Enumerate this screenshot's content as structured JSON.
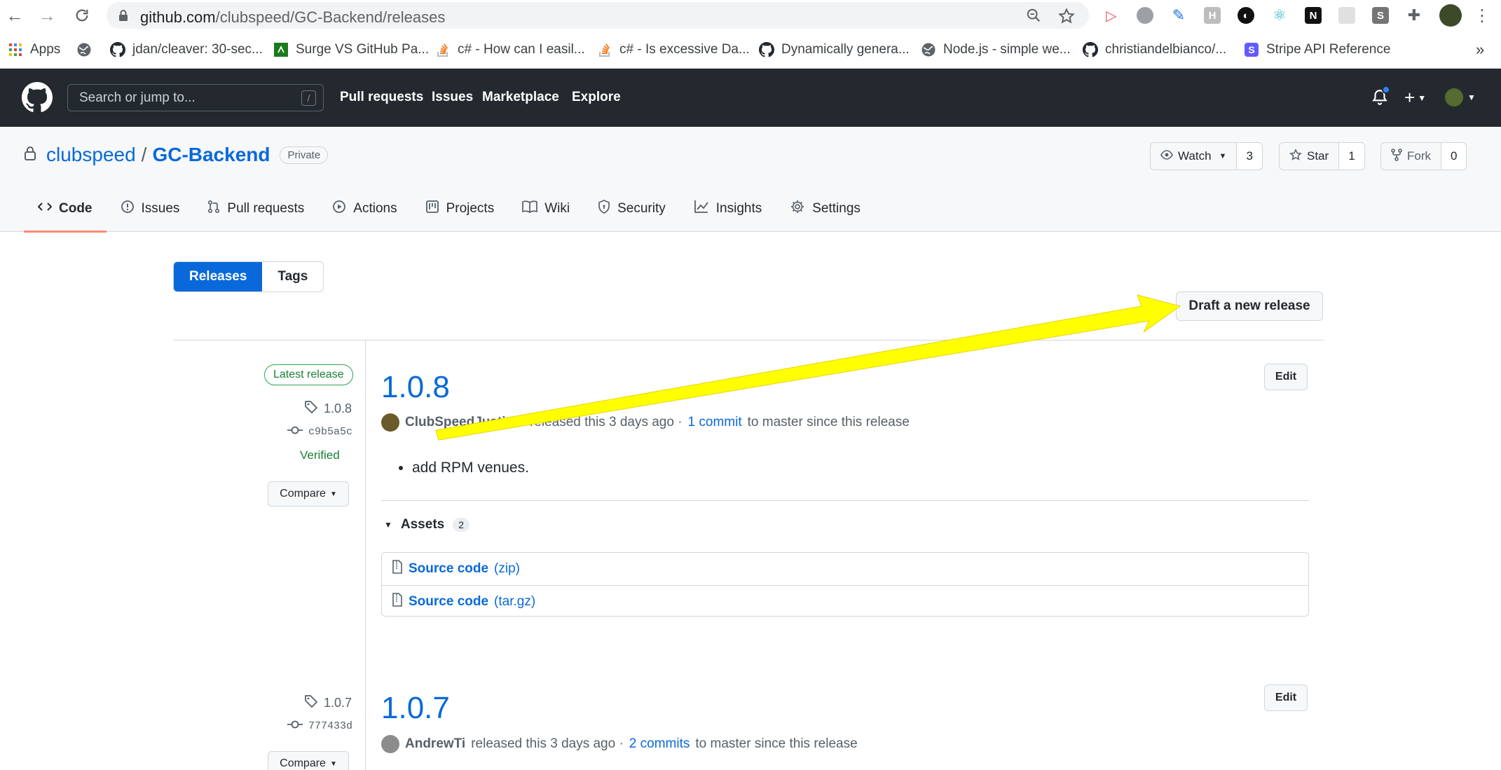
{
  "browser": {
    "url_host": "github.com",
    "url_path": "/clubspeed/GC-Backend/releases",
    "bookmarks": [
      {
        "label": "Apps",
        "icon": "apps-grid-icon"
      },
      {
        "label": "",
        "icon": "globe-icon"
      },
      {
        "label": "jdan/cleaver: 30-sec...",
        "icon": "github-icon"
      },
      {
        "label": "Surge VS GitHub Pa...",
        "icon": "surge-icon"
      },
      {
        "label": "c# - How can I easil...",
        "icon": "stackoverflow-icon"
      },
      {
        "label": "c# - Is excessive Da...",
        "icon": "stackoverflow-icon"
      },
      {
        "label": "Dynamically genera...",
        "icon": "github-icon"
      },
      {
        "label": "Node.js - simple we...",
        "icon": "globe-icon"
      },
      {
        "label": "christiandelbianco/...",
        "icon": "github-icon"
      },
      {
        "label": "Stripe API Reference",
        "icon": "stripe-icon"
      }
    ],
    "more_bookmarks": "»"
  },
  "header": {
    "search_placeholder": "Search or jump to...",
    "search_key": "/",
    "nav": [
      "Pull requests",
      "Issues",
      "Marketplace",
      "Explore"
    ]
  },
  "repo": {
    "owner": "clubspeed",
    "separator": "/",
    "name": "GC-Backend",
    "visibility": "Private",
    "watch_label": "Watch",
    "watch_count": "3",
    "star_label": "Star",
    "star_count": "1",
    "fork_label": "Fork",
    "fork_count": "0",
    "tabs": [
      "Code",
      "Issues",
      "Pull requests",
      "Actions",
      "Projects",
      "Wiki",
      "Security",
      "Insights",
      "Settings"
    ]
  },
  "releases_page": {
    "subnav": [
      "Releases",
      "Tags"
    ],
    "draft_button": "Draft a new release",
    "releases": [
      {
        "badge": "Latest release",
        "tag": "1.0.8",
        "commit": "c9b5a5c",
        "verified": "Verified",
        "compare": "Compare",
        "title": "1.0.8",
        "author": "ClubSpeedJustinG",
        "released_text": "released this 3 days ago ·",
        "commits_link": "1 commit",
        "since_text": "to master since this release",
        "edit": "Edit",
        "notes": [
          "add RPM venues."
        ],
        "assets_label": "Assets",
        "assets_count": "2",
        "assets": [
          {
            "name": "Source code",
            "ext": "(zip)"
          },
          {
            "name": "Source code",
            "ext": "(tar.gz)"
          }
        ]
      },
      {
        "tag": "1.0.7",
        "commit": "777433d",
        "compare": "Compare",
        "title": "1.0.7",
        "author": "AndrewTi",
        "released_text": "released this 3 days ago ·",
        "commits_link": "2 commits",
        "since_text": "to master since this release",
        "edit": "Edit"
      }
    ]
  },
  "annotation": {
    "arrow_color": "#ffff00",
    "arrow_points_to": "draft-new-release-button"
  }
}
